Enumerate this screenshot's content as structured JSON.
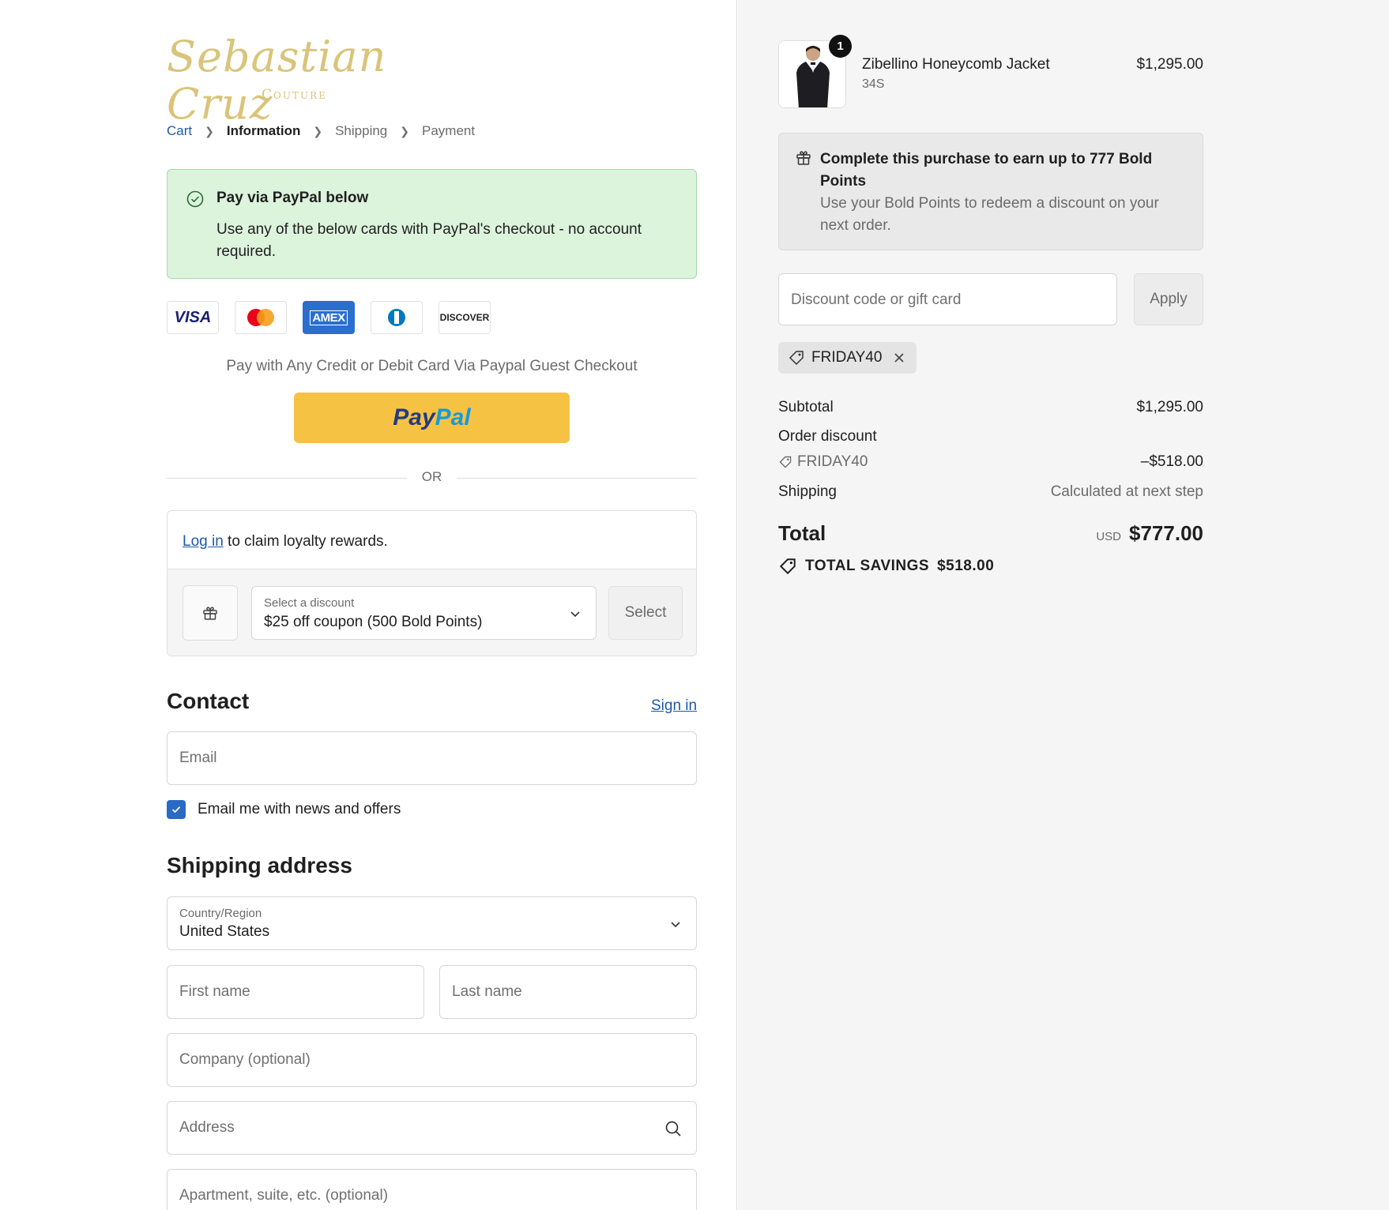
{
  "brand": {
    "name": "Sebastian Cruz",
    "subtitle": "Couture"
  },
  "breadcrumbs": {
    "cart": "Cart",
    "information": "Information",
    "shipping": "Shipping",
    "payment": "Payment"
  },
  "paypal_notice": {
    "title": "Pay via PayPal below",
    "body": "Use any of the below cards with PayPal's checkout - no account required."
  },
  "cards": {
    "visa": "VISA",
    "amex": "AMEX",
    "discover": "DISCOVER"
  },
  "pay_any_text": "Pay with Any Credit or Debit Card Via Paypal Guest Checkout",
  "paypal_button": {
    "part1": "Pay",
    "part2": "Pal"
  },
  "or_text": "OR",
  "loyalty": {
    "login_link": "Log in",
    "login_rest": " to claim loyalty rewards.",
    "select_label": "Select a discount",
    "select_value": "$25 off coupon (500 Bold Points)",
    "select_button": "Select"
  },
  "contact": {
    "heading": "Contact",
    "sign_in": "Sign in",
    "email_placeholder": "Email",
    "newsletter_label": "Email me with news and offers",
    "newsletter_checked": true
  },
  "shipping_address": {
    "heading": "Shipping address",
    "country_label": "Country/Region",
    "country_value": "United States",
    "first_name": "First name",
    "last_name": "Last name",
    "company": "Company (optional)",
    "address": "Address",
    "apartment": "Apartment, suite, etc. (optional)"
  },
  "order": {
    "product": {
      "name": "Zibellino Honeycomb Jacket",
      "variant": "34S",
      "price": "$1,295.00",
      "quantity": "1"
    },
    "earn": {
      "title": "Complete this purchase to earn up to 777 Bold Points",
      "body": "Use your Bold Points to redeem a discount on your next order."
    },
    "discount_placeholder": "Discount code or gift card",
    "apply_label": "Apply",
    "applied_code": "FRIDAY40",
    "subtotal_label": "Subtotal",
    "subtotal_value": "$1,295.00",
    "order_discount_label": "Order discount",
    "order_discount_code": "FRIDAY40",
    "order_discount_value": "–$518.00",
    "shipping_label": "Shipping",
    "shipping_value": "Calculated at next step",
    "total_label": "Total",
    "currency": "USD",
    "total_value": "$777.00",
    "savings_label": "TOTAL SAVINGS",
    "savings_value": "$518.00"
  }
}
